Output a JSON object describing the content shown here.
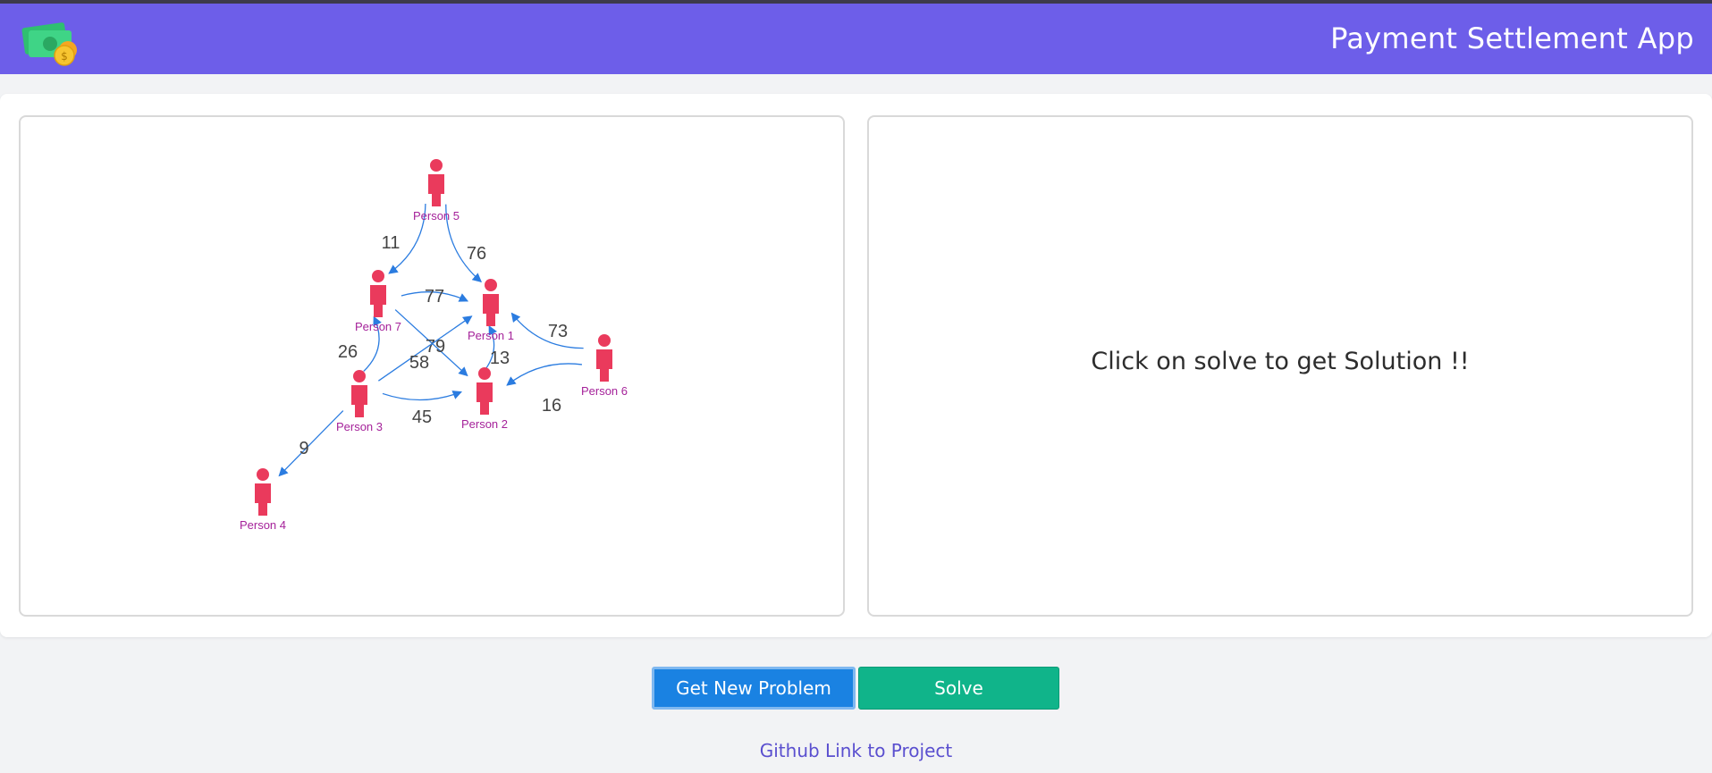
{
  "header": {
    "title": "Payment Settlement App",
    "logo_icon": "money-coins-icon",
    "background": "#6d5ee9"
  },
  "graph": {
    "nodes": [
      {
        "id": "p1",
        "label": "Person 1"
      },
      {
        "id": "p2",
        "label": "Person 2"
      },
      {
        "id": "p3",
        "label": "Person 3"
      },
      {
        "id": "p4",
        "label": "Person 4"
      },
      {
        "id": "p5",
        "label": "Person 5"
      },
      {
        "id": "p6",
        "label": "Person 6"
      },
      {
        "id": "p7",
        "label": "Person 7"
      }
    ],
    "edges": [
      {
        "from": "p5",
        "to": "p7",
        "amount": "11"
      },
      {
        "from": "p5",
        "to": "p1",
        "amount": "76"
      },
      {
        "from": "p7",
        "to": "p1",
        "amount": "77"
      },
      {
        "from": "p6",
        "to": "p1",
        "amount": "73"
      },
      {
        "from": "p3",
        "to": "p7",
        "amount": "26"
      },
      {
        "from": "p7",
        "to": "p2",
        "amount": "79"
      },
      {
        "from": "p3",
        "to": "p1",
        "amount": "58"
      },
      {
        "from": "p2",
        "to": "p1",
        "amount": "13"
      },
      {
        "from": "p6",
        "to": "p2",
        "amount": "16"
      },
      {
        "from": "p3",
        "to": "p2",
        "amount": "45"
      },
      {
        "from": "p3",
        "to": "p4",
        "amount": "9"
      }
    ],
    "node_color": "#ea3a5c",
    "edge_color": "#2b7ce0"
  },
  "solution": {
    "message": "Click on solve to get Solution !!"
  },
  "buttons": {
    "new_problem": "Get New Problem",
    "solve": "Solve"
  },
  "footer": {
    "github_link": "Github Link to Project"
  }
}
